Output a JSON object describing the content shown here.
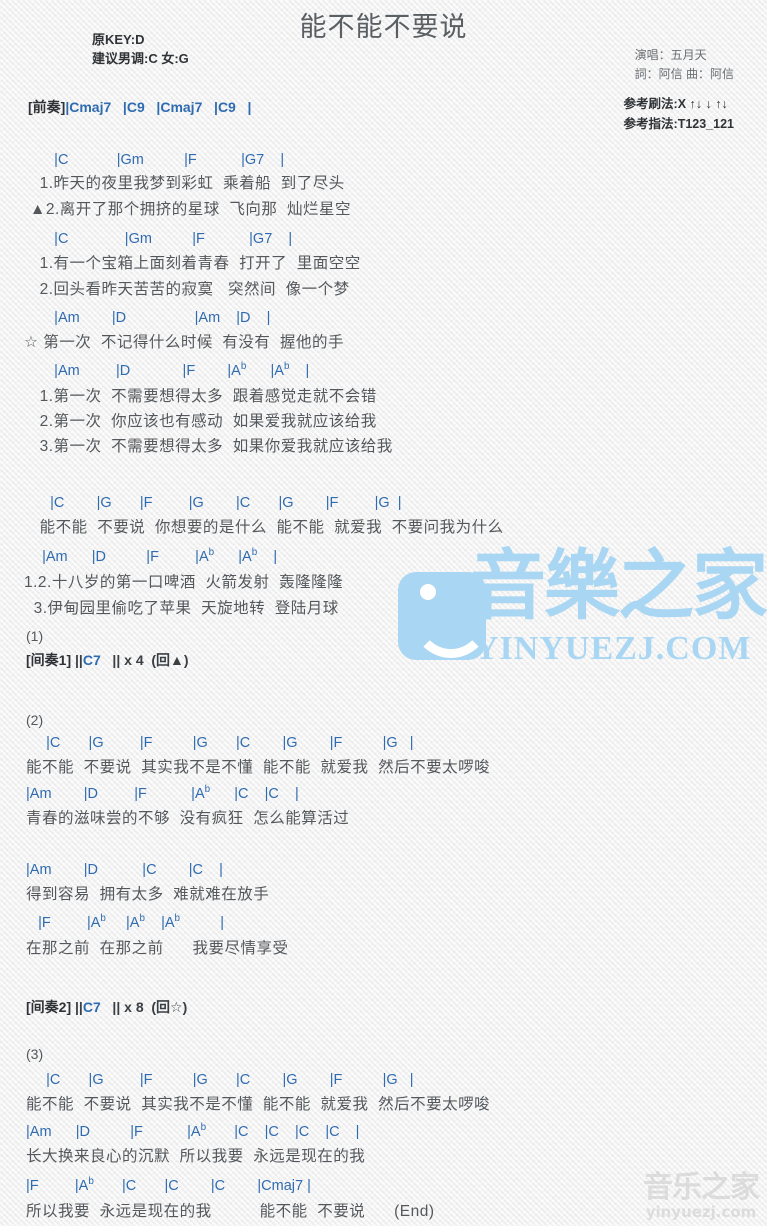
{
  "meta": {
    "title": "能不能不要说",
    "key_original": "原KEY:D",
    "key_suggest": "建议男调:C 女:G",
    "singer": "演唱：五月天",
    "writer": "詞：阿信  曲：阿信",
    "strum": "参考刷法:X ↑↓ ↓ ↑↓",
    "fingering": "参考指法:T123_121"
  },
  "colors": {
    "chord": "#2f6bb0",
    "lyric": "#54585c",
    "bar": "#33404d",
    "watermark_blue": "#a9d6f2",
    "watermark_gray": "#c9c9c9",
    "background": "#f2f2f2"
  },
  "watermarks": {
    "center_cn": "音樂之家",
    "center_url": "YINYUEZJ.COM",
    "corner_cn": "音乐之家",
    "corner_url": "yinyuezj.com"
  },
  "intro": {
    "label": "[前奏]",
    "chords": "|Cmaj7   |C9   |Cmaj7   |C9   |"
  },
  "sections": [
    {
      "name": "verse-1a",
      "chords": "    |C            |Gm         |F          |G7   |",
      "lyrics": [
        "  1.昨天的夜里我梦到彩虹  乘着船  到了尽头",
        "▲2.离开了那个拥挤的星球  飞向那  灿烂星空"
      ]
    },
    {
      "name": "verse-1b",
      "chords": "    |C            |Gm         |F          |G7   |",
      "lyrics": [
        "  1.有一个宝箱上面刻着青春  打开了  里面空空",
        "  2.回头看昨天苦苦的寂寞   突然间  像一个梦"
      ]
    },
    {
      "name": "prechorus-star",
      "chords": "    |Am        |D                |Am    |D    |",
      "lyrics": [
        "☆ 第一次  不记得什么时候  有没有  握他的手"
      ]
    },
    {
      "name": "prechorus-2",
      "chords": "    |Am         |D            |F       |Ab     |Ab   |",
      "lyrics": [
        "  1.第一次  不需要想得太多  跟着感觉走就不会错",
        "  2.第一次  你应该也有感动  如果爱我就应该给我",
        "  3.第一次  不需要想得太多  如果你爱我就应该给我"
      ]
    },
    {
      "name": "chorus-1",
      "chords": "    |C      |G      |F        |G      |C      |G      |F       |G  |",
      "lyrics": [
        "  能不能  不要说  你想要的是什么  能不能  就爱我  不要问我为什么"
      ]
    },
    {
      "name": "chorus-1b",
      "chords": "  |Am     |D         |F        |Ab     |Ab   |",
      "lyrics": [
        "1.2.十八岁的第一口啤酒  火箭发射  轰隆隆隆",
        "  3.伊甸园里偷吃了苹果  天旋地转  登陆月球"
      ]
    }
  ],
  "interlude1": {
    "number": "(1)",
    "label": "[间奏1]",
    "chords": "||C7   || x 4  (回▲)"
  },
  "section2": {
    "number": "(2)",
    "blocks": [
      {
        "name": "chorus-2",
        "chords": "   |C      |G        |F          |G      |C       |G       |F         |G   |",
        "lyrics": [
          "能不能  不要说  其实我不是不懂  能不能  就爱我  然后不要太啰唆"
        ]
      },
      {
        "name": "chorus-2b",
        "chords": "|Am       |D        |F          |Ab     |C   |C   |",
        "lyrics": [
          "青春的滋味尝的不够  没有疯狂  怎么能算活过"
        ]
      },
      {
        "name": "bridge-a",
        "chords": "|Am       |D          |C       |C   |",
        "lyrics": [
          "得到容易  拥有太多  难就难在放手"
        ]
      },
      {
        "name": "bridge-b",
        "chords": "  |F         |Ab    |Ab   |Ab         |",
        "lyrics": [
          "在那之前  在那之前      我要尽情享受"
        ]
      }
    ]
  },
  "interlude2": {
    "label": "[间奏2]",
    "chords": "||C7   || x 8  (回☆)"
  },
  "section3": {
    "number": "(3)",
    "blocks": [
      {
        "name": "chorus-3",
        "chords": "   |C      |G        |F          |G      |C       |G       |F         |G   |",
        "lyrics": [
          "能不能  不要说  其实我不是不懂  能不能  就爱我  然后不要太啰唆"
        ]
      },
      {
        "name": "outro-a",
        "chords": "|Am     |D         |F          |Ab      |C   |C   |C   |C   |",
        "lyrics": [
          "长大换来良心的沉默  所以我要  永远是现在的我"
        ]
      },
      {
        "name": "outro-b",
        "chords": "|F        |Ab      |C      |C       |C       |Cmaj7 |",
        "lyrics": [
          "所以我要  永远是现在的我          能不能  不要说      (End)"
        ]
      }
    ]
  }
}
